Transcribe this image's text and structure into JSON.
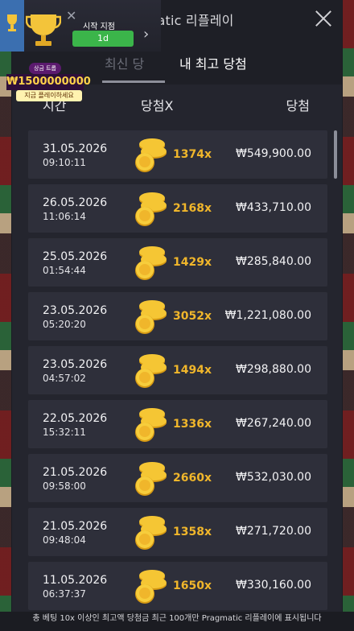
{
  "header": {
    "title": "Pragmatic 리플레이",
    "tabs": [
      {
        "label": "최신 당"
      },
      {
        "label": "내 최고 당첨"
      }
    ]
  },
  "columns": {
    "time": "시간",
    "multiplier": "당첨X",
    "win": "당첨"
  },
  "rows": [
    {
      "date": "31.05.2026",
      "time": "09:10:11",
      "multiplier": "1374x",
      "win": "₩549,900.00"
    },
    {
      "date": "26.05.2026",
      "time": "11:06:14",
      "multiplier": "2168x",
      "win": "₩433,710.00"
    },
    {
      "date": "25.05.2026",
      "time": "01:54:44",
      "multiplier": "1429x",
      "win": "₩285,840.00"
    },
    {
      "date": "23.05.2026",
      "time": "05:20:20",
      "multiplier": "3052x",
      "win": "₩1,221,080.00"
    },
    {
      "date": "23.05.2026",
      "time": "04:57:02",
      "multiplier": "1494x",
      "win": "₩298,880.00"
    },
    {
      "date": "22.05.2026",
      "time": "15:32:11",
      "multiplier": "1336x",
      "win": "₩267,240.00"
    },
    {
      "date": "21.05.2026",
      "time": "09:58:00",
      "multiplier": "2660x",
      "win": "₩532,030.00"
    },
    {
      "date": "21.05.2026",
      "time": "09:48:04",
      "multiplier": "1358x",
      "win": "₩271,720.00"
    },
    {
      "date": "11.05.2026",
      "time": "06:37:37",
      "multiplier": "1650x",
      "win": "₩330,160.00"
    }
  ],
  "footer": {
    "note": "총 베팅 10x 이상인 최고액 당첨금 최근 100개만 Pragmatic 리플레이에 표시됩니다"
  },
  "promo": {
    "start_label": "시작 지점",
    "start_value": "1d",
    "banner_top": "상금 트롭",
    "banner_amount": "₩1500000000",
    "banner_sub": "지금 플레이하세요"
  },
  "colors": {
    "accent": "#f0b62b",
    "panel": "#24252e",
    "row": "#2e2f3a",
    "start_pill": "#3bb54a"
  },
  "icons": {
    "close": "close-icon",
    "coin": "coin-stack-icon",
    "trophy": "trophy-icon",
    "chevron": "chevron-right-icon"
  }
}
